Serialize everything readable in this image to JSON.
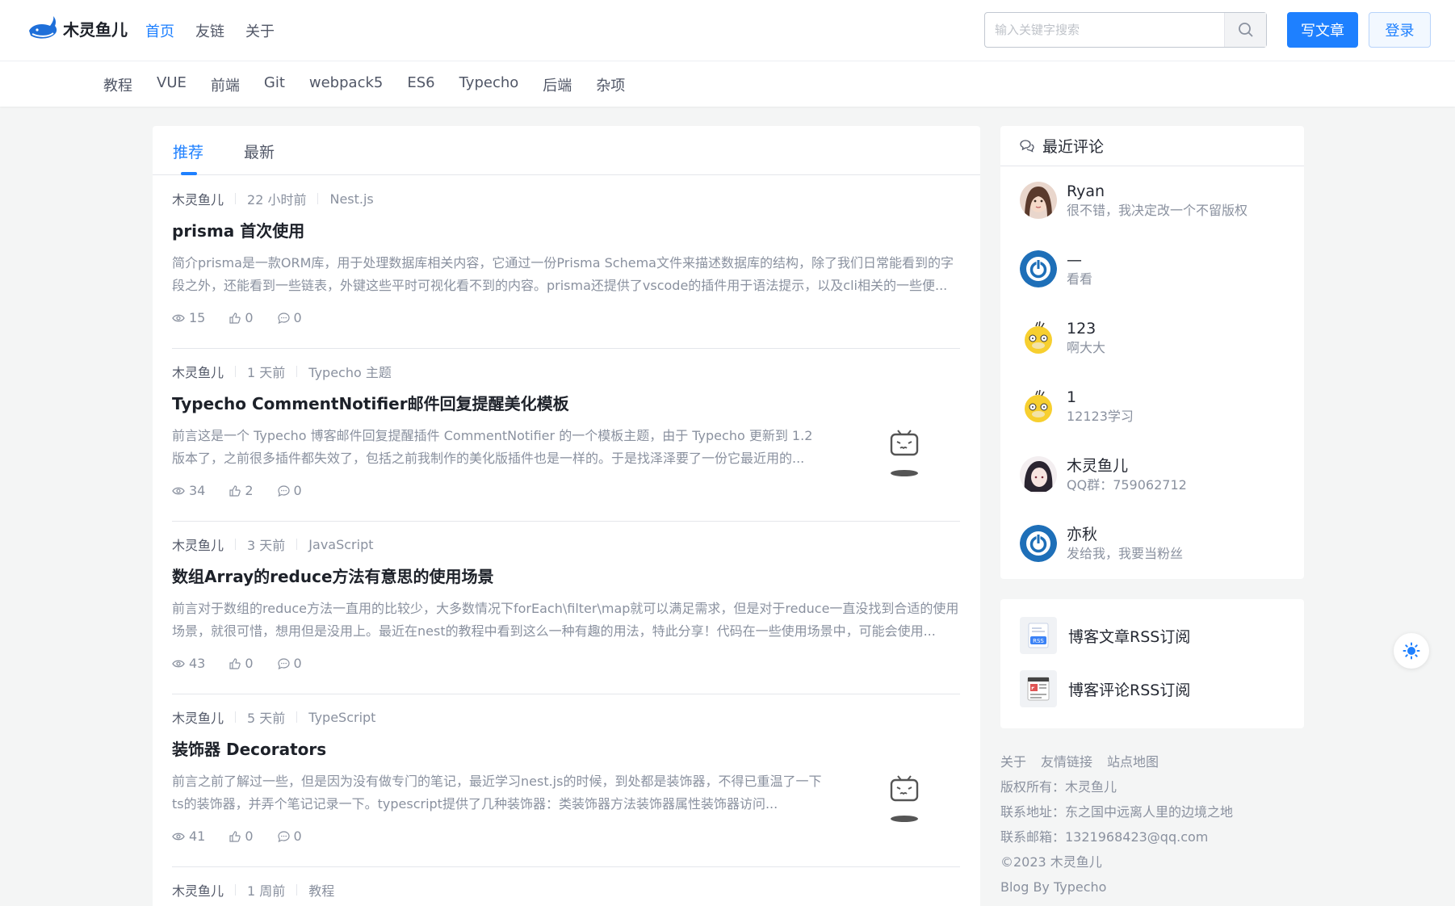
{
  "header": {
    "logo_text": "木灵鱼儿",
    "nav": [
      "首页",
      "友链",
      "关于"
    ],
    "search_placeholder": "输入关键字搜索",
    "write_label": "写文章",
    "login_label": "登录"
  },
  "categories": [
    "教程",
    "VUE",
    "前端",
    "Git",
    "webpack5",
    "ES6",
    "Typecho",
    "后端",
    "杂项"
  ],
  "tabs": [
    "推荐",
    "最新"
  ],
  "articles": [
    {
      "author": "木灵鱼儿",
      "time": "22 小时前",
      "category": "Nest.js",
      "title": "prisma 首次使用",
      "desc": "简介prisma是一款ORM库，用于处理数据库相关内容，它通过一份Prisma Schema文件来描述数据库的结构，除了我们日常能看到的字段之外，还能看到一些链表，外键这些平时可视化看不到的内容。prisma还提供了vscode的插件用于语法提示，以及cli相关的一些便...",
      "views": "15",
      "likes": "0",
      "comments": "0"
    },
    {
      "author": "木灵鱼儿",
      "time": "1 天前",
      "category": "Typecho 主题",
      "title": "Typecho CommentNotifier邮件回复提醒美化模板",
      "desc": "前言这是一个 Typecho 博客邮件回复提醒插件 CommentNotifier 的一个模板主题，由于 Typecho 更新到 1.2 版本了，之前很多插件都失效了，包括之前我制作的美化版插件也是一样的。于是找泽泽要了一份它最近用的...",
      "views": "34",
      "likes": "2",
      "comments": "0"
    },
    {
      "author": "木灵鱼儿",
      "time": "3 天前",
      "category": "JavaScript",
      "title": "数组Array的reduce方法有意思的使用场景",
      "desc": "前言对于数组的reduce方法一直用的比较少，大多数情况下forEach\\filter\\map就可以满足需求，但是对于reduce一直没找到合适的使用场景，就很可惜，想用但是没用上。最近在nest的教程中看到这么一种有趣的用法，特此分享！代码在一些使用场景中，可能会使用...",
      "views": "43",
      "likes": "0",
      "comments": "0"
    },
    {
      "author": "木灵鱼儿",
      "time": "5 天前",
      "category": "TypeScript",
      "title": "装饰器 Decorators",
      "desc": "前言之前了解过一些，但是因为没有做专门的笔记，最近学习nest.js的时候，到处都是装饰器，不得已重温了一下ts的装饰器，并弄个笔记记录一下。typescript提供了几种装饰器：类装饰器方法装饰器属性装饰器访问...",
      "views": "41",
      "likes": "0",
      "comments": "0"
    },
    {
      "author": "木灵鱼儿",
      "time": "1 周前",
      "category": "教程"
    }
  ],
  "recent_comments": {
    "title": "最近评论",
    "items": [
      {
        "name": "Ryan",
        "text": "很不错，我决定改一个不留版权"
      },
      {
        "name": "—",
        "text": "看看"
      },
      {
        "name": "123",
        "text": "啊大大"
      },
      {
        "name": "1",
        "text": "12123学习"
      },
      {
        "name": "木灵鱼儿",
        "text": "QQ群：759062712"
      },
      {
        "name": "亦秋",
        "text": "发给我，我要当粉丝"
      }
    ]
  },
  "rss": {
    "articles_label": "博客文章RSS订阅",
    "comments_label": "博客评论RSS订阅",
    "badge": "RSS"
  },
  "footer": {
    "links": [
      "关于",
      "友情链接",
      "站点地图"
    ],
    "copyright_owner": "版权所有：木灵鱼儿",
    "address": "联系地址：东之国中远离人里的边境之地",
    "email": "联系邮箱：1321968423@qq.com",
    "year": "©2023 木灵鱼儿",
    "powered": "Blog By Typecho"
  },
  "colors": {
    "accent": "#1e80ff",
    "text": "#252933",
    "muted": "#8a919f"
  }
}
